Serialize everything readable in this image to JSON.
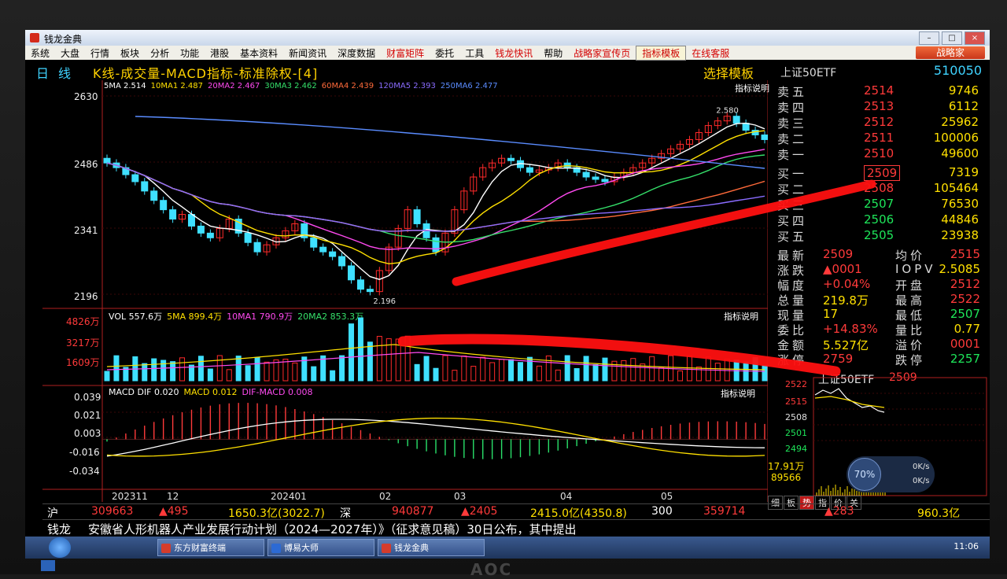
{
  "window": {
    "title": "钱龙金典"
  },
  "menu": [
    {
      "label": "系统",
      "style": ""
    },
    {
      "label": "大盘",
      "style": ""
    },
    {
      "label": "行情",
      "style": ""
    },
    {
      "label": "板块",
      "style": ""
    },
    {
      "label": "分析",
      "style": ""
    },
    {
      "label": "功能",
      "style": ""
    },
    {
      "label": "港股",
      "style": ""
    },
    {
      "label": "基本资料",
      "style": ""
    },
    {
      "label": "新闻资讯",
      "style": ""
    },
    {
      "label": "深度数据",
      "style": ""
    },
    {
      "label": "财富矩阵",
      "style": "red"
    },
    {
      "label": "委托",
      "style": ""
    },
    {
      "label": "工具",
      "style": ""
    },
    {
      "label": "钱龙快讯",
      "style": "red"
    },
    {
      "label": "帮助",
      "style": ""
    },
    {
      "label": "战略家宣传页",
      "style": "red"
    },
    {
      "label": "指标模板",
      "style": "box"
    },
    {
      "label": "在线客服",
      "style": "red"
    }
  ],
  "brand_button": "战略家",
  "header": {
    "period": "日线",
    "title": "K线-成交量-MACD指标-标准除权-[4]",
    "template": "选择模板",
    "symbol": "上证50ETF",
    "code": "510050"
  },
  "ma_legend": [
    {
      "text": "5MA 2.514",
      "color": "#ffffff"
    },
    {
      "text": "10MA1 2.487",
      "color": "#ffe000"
    },
    {
      "text": "20MA2 2.467",
      "color": "#ff4af0"
    },
    {
      "text": "30MA3 2.462",
      "color": "#35e06a"
    },
    {
      "text": "60MA4 2.439",
      "color": "#ff6a3a"
    },
    {
      "text": "120MA5 2.393",
      "color": "#8a6cff"
    },
    {
      "text": "250MA6 2.477",
      "color": "#5a8cff"
    }
  ],
  "indicator_link": "指标说明",
  "price_axis": [
    "2630",
    "2486",
    "2341",
    "2196"
  ],
  "price_annotations": {
    "high": "2.580",
    "low": "2.196"
  },
  "vol_legend": [
    {
      "text": "VOL 557.6万",
      "color": "#ffffff"
    },
    {
      "text": "5MA 899.4万",
      "color": "#ffe000"
    },
    {
      "text": "10MA1 790.9万",
      "color": "#ff4af0"
    },
    {
      "text": "20MA2 853.3万",
      "color": "#35e06a"
    }
  ],
  "vol_axis": [
    "4826万",
    "3217万",
    "1609万"
  ],
  "macd_legend": [
    {
      "text": "MACD DIF 0.020",
      "color": "#ffffff"
    },
    {
      "text": "MACD 0.012",
      "color": "#ffe000"
    },
    {
      "text": "DIF-MACD 0.008",
      "color": "#ff4af0"
    }
  ],
  "macd_axis": [
    "0.039",
    "0.021",
    "0.003",
    "-0.016",
    "-0.034"
  ],
  "x_axis": [
    "202311",
    "12",
    "202401",
    "02",
    "03",
    "04",
    "05"
  ],
  "order_book": {
    "asks": [
      {
        "label": "卖五",
        "price": "2514",
        "vol": "9746"
      },
      {
        "label": "卖四",
        "price": "2513",
        "vol": "6112"
      },
      {
        "label": "卖三",
        "price": "2512",
        "vol": "25962"
      },
      {
        "label": "卖二",
        "price": "2511",
        "vol": "100006"
      },
      {
        "label": "卖一",
        "price": "2510",
        "vol": "49600"
      }
    ],
    "bids": [
      {
        "label": "买一",
        "price": "2509",
        "vol": "7319"
      },
      {
        "label": "买二",
        "price": "2508",
        "vol": "105464"
      },
      {
        "label": "买三",
        "price": "2507",
        "vol": "76530"
      },
      {
        "label": "买四",
        "price": "2506",
        "vol": "44846"
      },
      {
        "label": "买五",
        "price": "2505",
        "vol": "23938"
      }
    ]
  },
  "stats": [
    {
      "l": "最新",
      "v": "2509",
      "vcolor": "#ff3a3a",
      "l2": "均价",
      "v2": "2515",
      "v2color": "#ff3a3a"
    },
    {
      "l": "涨跌",
      "v": "▲0001",
      "vcolor": "#ff3a3a",
      "l2": "IOPV",
      "v2": "2.5085",
      "v2color": "#ffe000"
    },
    {
      "l": "幅度",
      "v": "+0.04%",
      "vcolor": "#ff3a3a",
      "l2": "开盘",
      "v2": "2512",
      "v2color": "#ff3a3a"
    },
    {
      "l": "总量",
      "v": "219.8万",
      "vcolor": "#ffe000",
      "l2": "最高",
      "v2": "2522",
      "v2color": "#ff3a3a"
    },
    {
      "l": "现量",
      "v": "17",
      "vcolor": "#ffe000",
      "l2": "最低",
      "v2": "2507",
      "v2color": "#1ee65a"
    },
    {
      "l": "委比",
      "v": "+14.83%",
      "vcolor": "#ff3a3a",
      "l2": "量比",
      "v2": "0.77",
      "v2color": "#ffe000"
    },
    {
      "l": "金额",
      "v": "5.527亿",
      "vcolor": "#ffe000",
      "l2": "溢价",
      "v2": "0001",
      "v2color": "#ff3a3a"
    },
    {
      "l": "涨停",
      "v": "2759",
      "vcolor": "#ff3a3a",
      "l2": "跌停",
      "v2": "2257",
      "v2color": "#1ee65a"
    }
  ],
  "mini_chart": {
    "title": "上证50ETF",
    "price": "2509",
    "axis": [
      "2522",
      "2515",
      "2508",
      "2501",
      "2494"
    ],
    "vol_top": "17.91万",
    "vol_mid": "89566",
    "tabs": [
      "细",
      "板",
      "势",
      "指",
      "价",
      "关"
    ],
    "active_tab": "势"
  },
  "speed_widget": {
    "percent": "70%",
    "up": "0K/s",
    "down": "0K/s"
  },
  "ticker": [
    {
      "t": "沪",
      "c": "#ffffff"
    },
    {
      "t": "309663",
      "c": "#ff3a3a"
    },
    {
      "t": "▲495",
      "c": "#ff3a3a"
    },
    {
      "t": "1650.3亿(3022.7)",
      "c": "#ffe000"
    },
    {
      "t": "深",
      "c": "#ffffff"
    },
    {
      "t": "940877",
      "c": "#ff3a3a"
    },
    {
      "t": "▲2405",
      "c": "#ff3a3a"
    },
    {
      "t": "2415.0亿(4350.8)",
      "c": "#ffe000"
    },
    {
      "t": "300",
      "c": "#ffffff"
    },
    {
      "t": "359714",
      "c": "#ff3a3a"
    },
    {
      "t": "▲283",
      "c": "#ff3a3a"
    },
    {
      "t": "960.3亿",
      "c": "#ffe000"
    }
  ],
  "news": {
    "label": "钱龙",
    "text": "安徽省人形机器人产业发展行动计划（2024—2027年）》（征求意见稿）30日公布，其中提出"
  },
  "taskbar": {
    "items": [
      "东方财富终端",
      "博易大师",
      "钱龙金典"
    ],
    "time": "11:06"
  },
  "monitor_brand": "AOC",
  "chart_data": {
    "type": "candlestick",
    "title": "K线-成交量-MACD指标-标准除权-[4]",
    "price_range": [
      2196,
      2630
    ],
    "high": 2580,
    "low": 2196,
    "months": [
      "202311",
      "12",
      "202401",
      "02",
      "03",
      "04",
      "05"
    ],
    "close": [
      2480,
      2470,
      2455,
      2440,
      2420,
      2400,
      2380,
      2360,
      2370,
      2345,
      2330,
      2320,
      2340,
      2360,
      2330,
      2310,
      2290,
      2305,
      2320,
      2335,
      2350,
      2320,
      2300,
      2290,
      2280,
      2260,
      2230,
      2210,
      2205,
      2250,
      2300,
      2340,
      2380,
      2350,
      2320,
      2290,
      2330,
      2380,
      2420,
      2450,
      2470,
      2480,
      2490,
      2485,
      2470,
      2460,
      2465,
      2470,
      2480,
      2470,
      2460,
      2450,
      2445,
      2440,
      2450,
      2460,
      2470,
      2480,
      2490,
      2500,
      2510,
      2520,
      2530,
      2545,
      2560,
      2570,
      2580,
      2565,
      2550,
      2540,
      2530
    ],
    "volume_range": [
      0,
      4826
    ],
    "macd_range": [
      -0.034,
      0.039
    ],
    "macd_dif_last": 0.02,
    "macd_dea_last": 0.012,
    "macd_hist_last": 0.008
  }
}
